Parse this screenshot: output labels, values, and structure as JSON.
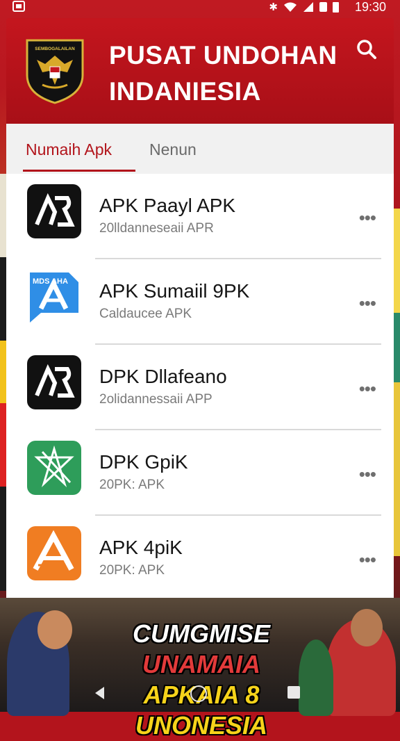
{
  "status_bar": {
    "time": "19:30",
    "icons": [
      "bluetooth-icon",
      "wifi-icon",
      "signal-icon",
      "sim-icon",
      "battery-icon"
    ]
  },
  "header": {
    "emblem_text": "SEMBOGALAILAN",
    "title_line1": "PUSAT UNDOHAN",
    "title_line2": "INDANIESIA",
    "search_icon": "search-icon"
  },
  "tabs": [
    {
      "label": "Numaih Apk",
      "active": true
    },
    {
      "label": "Nenun",
      "active": false
    }
  ],
  "apps": [
    {
      "name": "APK Paayl APK",
      "subtitle": "20lldanneseaii APR",
      "icon": "black-ar-logo",
      "icon_color": "#111111"
    },
    {
      "name": "APK Sumaiil 9PK",
      "subtitle": "Caldaucee APK",
      "icon": "blue-a-chat-logo",
      "icon_color": "#2f8ee6",
      "icon_label": "MDS AHA"
    },
    {
      "name": "DPK Dllafeano",
      "subtitle": "2olidannessaii APP",
      "icon": "black-ar-logo",
      "icon_color": "#111111"
    },
    {
      "name": "DPK GpiK",
      "subtitle": "20PK: APK",
      "icon": "green-star-logo",
      "icon_color": "#2e9d5a"
    },
    {
      "name": "APK 4piK",
      "subtitle": "20PK: APK",
      "icon": "orange-a-logo",
      "icon_color": "#f07d22"
    }
  ],
  "more_label": "•••",
  "banner": {
    "line1_white": "CUMGMISE",
    "line1_red": "UNAMAIA",
    "line2_yellow": "APKAIA 8 UNONESIA"
  },
  "colors": {
    "primary": "#b2141b",
    "header": "#c4161e",
    "accent_yellow": "#f6d31a"
  }
}
